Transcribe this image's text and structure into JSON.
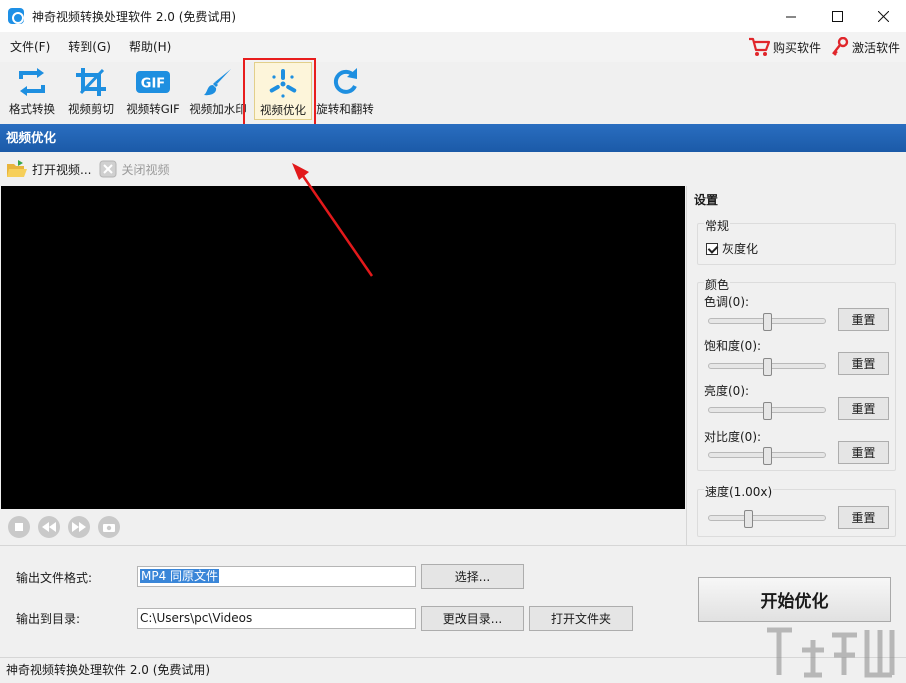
{
  "window": {
    "title": "神奇视频转换处理软件 2.0 (免费试用)"
  },
  "menu": {
    "items": [
      "文件(F)",
      "转到(G)",
      "帮助(H)"
    ],
    "buy": "购买软件",
    "activate": "激活软件"
  },
  "toolbar": {
    "tools": [
      {
        "label": "格式转换",
        "icon": "format-convert-icon"
      },
      {
        "label": "视频剪切",
        "icon": "crop-icon"
      },
      {
        "label": "视频转GIF",
        "icon": "gif-icon"
      },
      {
        "label": "视频加水印",
        "icon": "brush-icon"
      },
      {
        "label": "视频优化",
        "icon": "optimize-icon"
      },
      {
        "label": "旋转和翻转",
        "icon": "rotate-icon"
      }
    ],
    "active_index": 4,
    "gif_badge": "GIF"
  },
  "section": {
    "title": "视频优化"
  },
  "subtoolbar": {
    "open_video": "打开视频...",
    "close_video": "关闭视频"
  },
  "settings": {
    "title": "设置",
    "general": {
      "title": "常规",
      "grayscale_label": "灰度化",
      "grayscale_checked": true
    },
    "color": {
      "title": "颜色",
      "hue_label": "色调(0):",
      "saturation_label": "饱和度(0):",
      "brightness_label": "亮度(0):",
      "contrast_label": "对比度(0):",
      "hue_value": 0,
      "saturation_value": 0,
      "brightness_value": 0,
      "contrast_value": 0
    },
    "speed": {
      "title": "速度(1.00x)",
      "value": 1.0
    },
    "reset_label": "重置"
  },
  "output": {
    "format_label": "输出文件格式:",
    "format_value": "MP4 同原文件",
    "select_button": "选择...",
    "dir_label": "输出到目录:",
    "dir_value": "C:\\Users\\pc\\Videos",
    "change_dir_button": "更改目录...",
    "open_folder_button": "打开文件夹",
    "start_button": "开始优化"
  },
  "status": {
    "text": "神奇视频转换处理软件 2.0 (免费试用)"
  },
  "colors": {
    "accent": "#1b5aa8",
    "highlight": "#e81d1d",
    "icon_blue": "#1e8fe0"
  }
}
